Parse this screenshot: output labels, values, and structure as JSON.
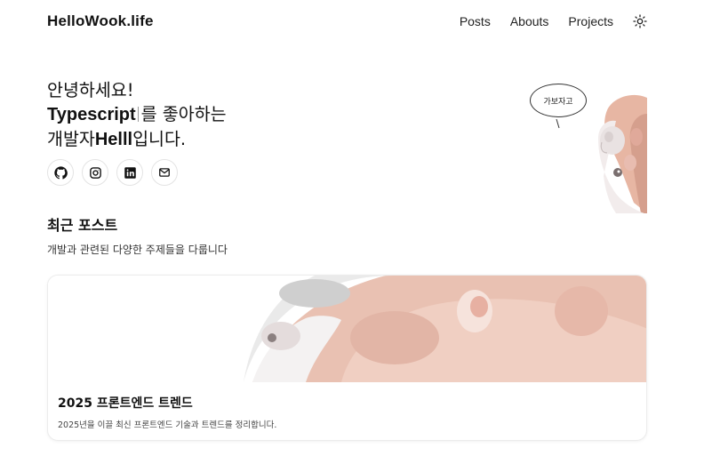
{
  "header": {
    "logo": "HelloWook.life",
    "nav": [
      {
        "label": "Posts"
      },
      {
        "label": "Abouts"
      },
      {
        "label": "Projects"
      }
    ],
    "theme_icon": "sun-icon"
  },
  "hero": {
    "line1": "안녕하세요!",
    "line2_strong": "Typescript",
    "line2_rest": "를 좋아하는",
    "line3_pre": "개발자",
    "line3_strong": "Helll",
    "line3_post": "입니다.",
    "socials": [
      {
        "icon": "github-icon"
      },
      {
        "icon": "instagram-icon"
      },
      {
        "icon": "linkedin-icon"
      },
      {
        "icon": "mail-icon"
      }
    ],
    "bubble_text": "가보자고"
  },
  "recent": {
    "title": "최근 포스트",
    "subtitle": "개발과 관련된 다양한 주제들을 다룹니다",
    "posts": [
      {
        "title": "2025 프론트엔드 트렌드",
        "description": "2025년을 이끌 최신 프론트엔드 기술과 트렌드를 정리합니다."
      }
    ]
  }
}
